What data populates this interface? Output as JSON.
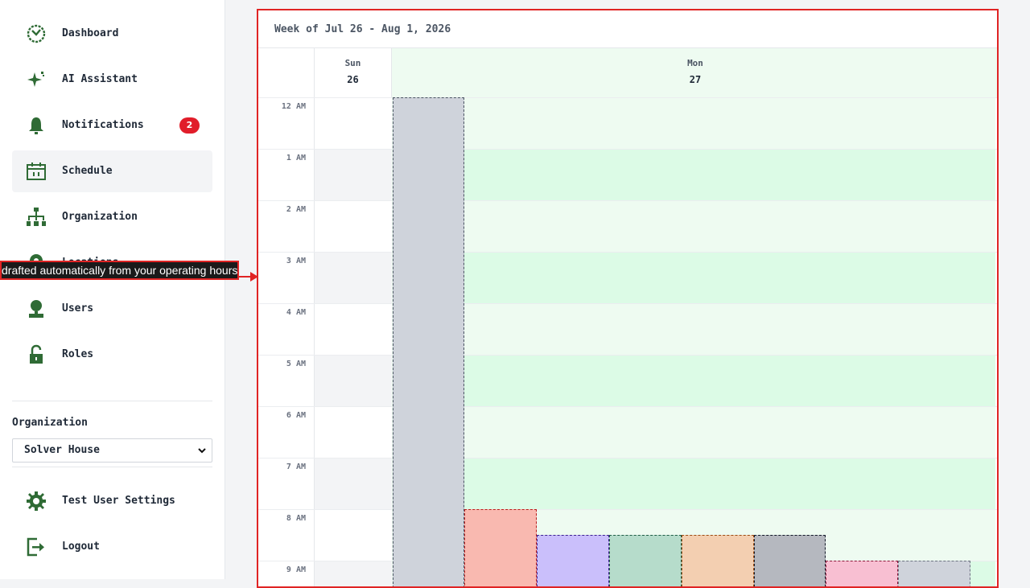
{
  "sidebar": {
    "items": [
      {
        "label": "Dashboard",
        "icon": "dashboard-icon",
        "badge": null
      },
      {
        "label": "AI Assistant",
        "icon": "sparkle-icon",
        "badge": null
      },
      {
        "label": "Notifications",
        "icon": "bell-icon",
        "badge": "2"
      },
      {
        "label": "Schedule",
        "icon": "calendar-icon",
        "badge": null,
        "active": true
      },
      {
        "label": "Organization",
        "icon": "org-chart-icon",
        "badge": null
      },
      {
        "label": "Locations",
        "icon": "location-pin-icon",
        "badge": null
      },
      {
        "label": "Users",
        "icon": "user-icon",
        "badge": null
      },
      {
        "label": "Roles",
        "icon": "lock-icon",
        "badge": null
      }
    ],
    "organization": {
      "label": "Organization",
      "selected": "Solver House"
    },
    "footer": [
      {
        "label": "Test User Settings",
        "icon": "gear-icon"
      },
      {
        "label": "Logout",
        "icon": "logout-icon"
      }
    ]
  },
  "tooltip": {
    "text": "drafted automatically from your operating hours"
  },
  "calendar": {
    "title": "Week of Jul 26 - Aug 1, 2026",
    "days": [
      {
        "name": "Sun",
        "date": "26"
      },
      {
        "name": "Mon",
        "date": "27"
      }
    ],
    "hours": [
      "12 AM",
      "1 AM",
      "2 AM",
      "3 AM",
      "4 AM",
      "5 AM",
      "6 AM",
      "7 AM",
      "8 AM",
      "9 AM"
    ]
  },
  "colors": {
    "accent_green": "#2f6b35",
    "badge_red": "#e11d2a",
    "highlight_border": "#e02424",
    "monday_bg_light": "#eefbf1",
    "monday_bg_dark": "#dcfbe6"
  }
}
